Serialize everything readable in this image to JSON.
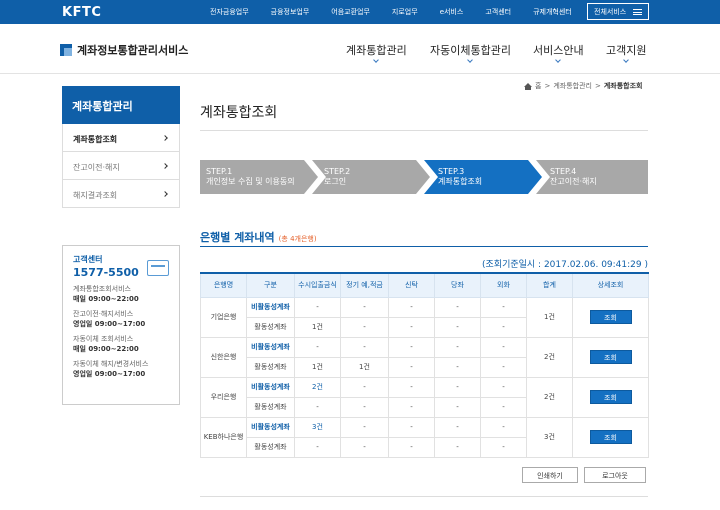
{
  "topbar": {
    "logo": "KFTC",
    "links": [
      "전자금융업무",
      "금융정보업무",
      "어음교환업무",
      "지로업무",
      "e서비스",
      "고객센터",
      "규제개혁센터"
    ],
    "all_services": "전체서비스"
  },
  "header": {
    "brand": "계좌정보통합관리서비스",
    "gnb": [
      "계좌통합관리",
      "자동이체통합관리",
      "서비스안내",
      "고객지원"
    ]
  },
  "sidebar": {
    "title": "계좌통합관리",
    "items": [
      {
        "label": "계좌통합조회",
        "active": true
      },
      {
        "label": "잔고이전·해지"
      },
      {
        "label": "해지결과조회"
      }
    ]
  },
  "customer_center": {
    "title": "고객센터",
    "phone": "1577-5500",
    "lines": [
      {
        "service": "계좌통합조회서비스",
        "hours": "매일 09:00~22:00"
      },
      {
        "service": "잔고이전·해지서비스",
        "hours": "영업일 09:00~17:00"
      },
      {
        "service": "자동이체 조회서비스",
        "hours": "매일 09:00~22:00"
      },
      {
        "service": "자동이체 해지/변경서비스",
        "hours": "영업일 09:00~17:00"
      }
    ]
  },
  "breadcrumb": {
    "home": "홈",
    "level1": "계좌통합관리",
    "current": "계좌통합조회"
  },
  "page_title": "계좌통합조회",
  "steps": [
    {
      "num": "STEP.1",
      "label": "개인정보 수집 및 이용동의",
      "active": false
    },
    {
      "num": "STEP.2",
      "label": "로그인",
      "active": false
    },
    {
      "num": "STEP.3",
      "label": "계좌통합조회",
      "active": true
    },
    {
      "num": "STEP.4",
      "label": "잔고이전·해지",
      "active": false
    }
  ],
  "section": {
    "title": "은행별 계좌내역",
    "count": "(총 4개은행)",
    "basis": "(조회기준일시 : 2017.02.06. 09:41:29 )"
  },
  "table": {
    "headers": [
      "은행명",
      "구분",
      "수시입출금식",
      "정기 예,적금",
      "신탁",
      "당좌",
      "외화",
      "합계",
      "상세조회"
    ],
    "banks": [
      {
        "name": "기업은행",
        "inactive_label": "비활동성계좌",
        "active_label": "활동성계좌",
        "inactive_vals": [
          "-",
          "-",
          "-",
          "-",
          "-"
        ],
        "active_vals": [
          "1건",
          "-",
          "-",
          "-",
          "-"
        ],
        "total": "1건",
        "button": "조회"
      },
      {
        "name": "신한은행",
        "inactive_label": "비활동성계좌",
        "active_label": "활동성계좌",
        "inactive_vals": [
          "-",
          "-",
          "-",
          "-",
          "-"
        ],
        "active_vals": [
          "1건",
          "1건",
          "-",
          "-",
          "-"
        ],
        "total": "2건",
        "button": "조회"
      },
      {
        "name": "우리은행",
        "inactive_label": "비활동성계좌",
        "active_label": "활동성계좌",
        "inactive_vals": [
          "2건",
          "-",
          "-",
          "-",
          "-"
        ],
        "active_vals": [
          "-",
          "-",
          "-",
          "-",
          "-"
        ],
        "total": "2건",
        "button": "조회"
      },
      {
        "name": "KEB하나은행",
        "inactive_label": "비활동성계좌",
        "active_label": "활동성계좌",
        "inactive_vals": [
          "3건",
          "-",
          "-",
          "-",
          "-"
        ],
        "active_vals": [
          "-",
          "-",
          "-",
          "-",
          "-"
        ],
        "total": "3건",
        "button": "조회"
      }
    ]
  },
  "buttons": {
    "print": "인쇄하기",
    "logout": "로그아웃"
  },
  "colors": {
    "brand_blue": "#0f5fa8",
    "step_active": "#1470c2",
    "step_inactive": "#a8a8a8",
    "count_orange": "#e5622c"
  }
}
